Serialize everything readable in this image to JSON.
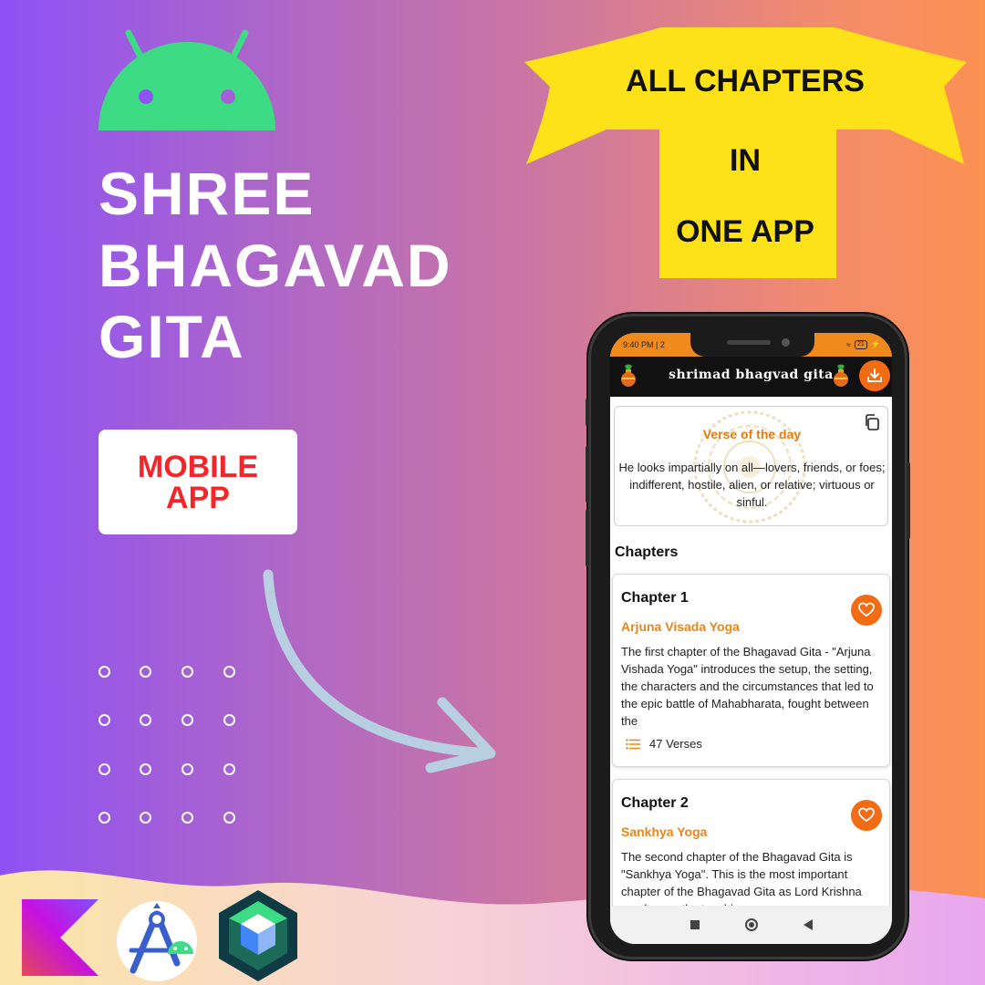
{
  "headline": {
    "line1": "SHREE",
    "line2": "BHAGAVAD",
    "line3": "GITA"
  },
  "badge": {
    "line1": "MOBILE",
    "line2": "APP"
  },
  "banner": {
    "line1": "ALL CHAPTERS",
    "line2": "IN",
    "line3": "ONE APP"
  },
  "logos": [
    "android-icon",
    "kotlin-icon",
    "android-studio-icon",
    "jetpack-compose-icon"
  ],
  "colors": {
    "accent": "#f26b15",
    "banner_yellow": "#fde21a",
    "android_green": "#3ddc84",
    "badge_red": "#f2262b"
  },
  "phone": {
    "status_time": "9:40 PM | 2",
    "status_right": "21",
    "app_title": "shrimad bhagvad gita",
    "verse": {
      "title": "Verse of the day",
      "text": "He looks impartially on all—lovers, friends, or foes; indifferent, hostile, alien, or relative; virtuous or sinful."
    },
    "section_title": "Chapters",
    "chapters": [
      {
        "number": "Chapter 1",
        "name": "Arjuna Visada Yoga",
        "desc": "The first chapter of the Bhagavad Gita - \"Arjuna Vishada Yoga\" introduces the setup, the setting, the characters and the circumstances that led to the epic battle of Mahabharata, fought between the",
        "verses": "47 Verses"
      },
      {
        "number": "Chapter 2",
        "name": "Sankhya Yoga",
        "desc": "The second chapter of the Bhagavad Gita is \"Sankhya Yoga\". This is the most important chapter of the Bhagavad Gita as Lord Krishna condenses the teachings"
      }
    ]
  }
}
